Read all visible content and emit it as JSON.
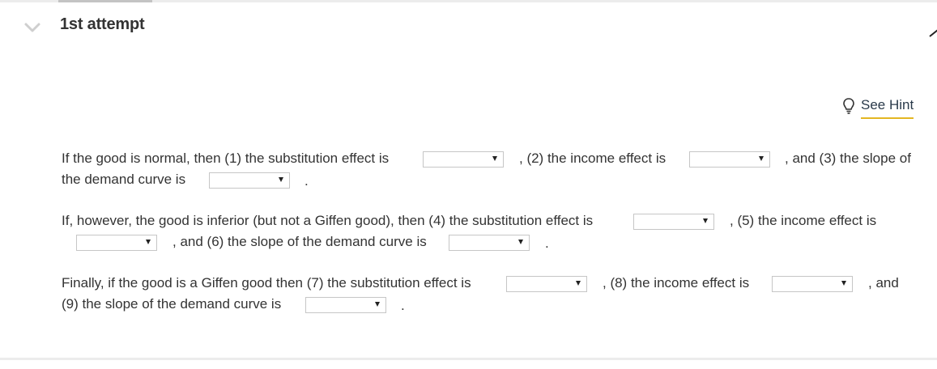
{
  "attempt": {
    "title": "1st attempt"
  },
  "hint": {
    "label": "See Hint",
    "icon": "lightbulb-icon",
    "underline_color": "#e4b622"
  },
  "questions": [
    {
      "line1_a": "If the good is normal, then (1) the substitution effect is",
      "line1_b": ", (2) the income effect is",
      "line1_c": ", and (3) the slope of",
      "line2_a": "the demand curve is",
      "end": "."
    },
    {
      "line1_a": "If, however, the good is inferior (but not a Giffen good), then (4) the substitution effect is",
      "line1_b": ", (5) the income effect is",
      "line2_a": ", and (6) the slope of the demand curve is",
      "end": "."
    },
    {
      "line1_a": "Finally, if the good is a Giffen good then (7) the substitution effect is",
      "line1_b": ", (8) the income effect is",
      "line1_c": ", and",
      "line2_a": "(9) the slope of the demand curve is",
      "end": "."
    }
  ],
  "dropdowns": {
    "selected": [
      "",
      "",
      "",
      "",
      "",
      "",
      "",
      "",
      ""
    ]
  }
}
